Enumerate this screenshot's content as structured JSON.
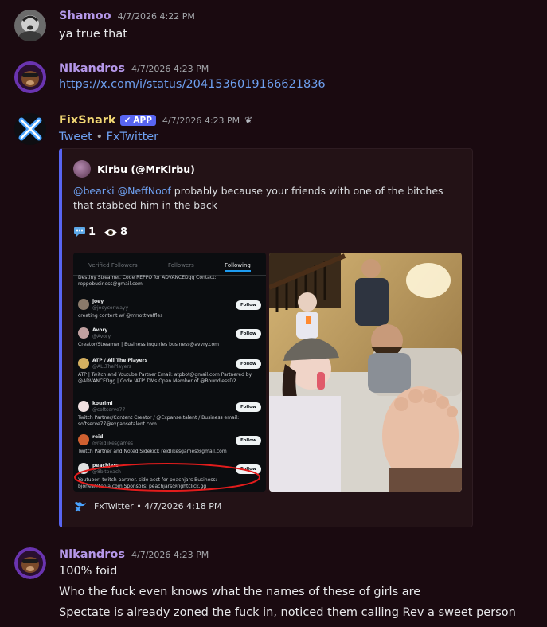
{
  "messages": [
    {
      "username": "Shamoo",
      "username_color": "#b497e8",
      "timestamp": "4/7/2026 4:22 PM",
      "lines": [
        "ya true that"
      ]
    },
    {
      "username": "Nikandros",
      "username_color": "#b497e8",
      "timestamp": "4/7/2026 4:23 PM",
      "link": "https://x.com/i/status/2041536019166621836"
    },
    {
      "username": "FixSnark",
      "username_color": "#f0d672",
      "badge": "APP",
      "timestamp": "4/7/2026 4:23 PM",
      "links": [
        "Tweet",
        "FxTwitter"
      ],
      "separator": "•",
      "embed": {
        "author": "Kirbu (@MrKirbu)",
        "mention1": "@bearki",
        "mention2": "@NeffNoof",
        "text": " probably because your friends with one of the bitches that stabbed him in the back",
        "replies": "1",
        "views": "8",
        "footer": "FxTwitter • 4/7/2026 4:18 PM",
        "accent_color": "#5865f2",
        "screenshot": {
          "tabs": [
            "Verified Followers",
            "Followers",
            "Following"
          ],
          "top_text": "Destiny Streamer. Code REPPO for ADVANCEDgg Contact: reppobusiness@gmail.com",
          "follow_label": "Follow",
          "accounts": [
            {
              "name": "joey",
              "handle": "@joeyconwayy",
              "bio": "creating content w/ @mrrottwaffles"
            },
            {
              "name": "Avory",
              "handle": "@Avory",
              "bio": "Creator/Streamer | Business Inquiries business@avvry.com"
            },
            {
              "name": "ATP / All The Players",
              "handle": "@ALLThePlayers",
              "bio": "ATP | Twitch and Youtube Partner Email: atpbot@gmail.com Partnered by @ADVANCEDgg | Code 'ATP' DMs Open Member of @BoundlessD2"
            },
            {
              "name": "kourimi",
              "handle": "@softserve77",
              "bio": "Twitch Partner/Content Creator / @Expanse.talent / Business email: softserve77@expansetalent.com"
            },
            {
              "name": "reid",
              "handle": "@reidlikesgames",
              "bio": "Twitch Partner and Noted Sidekick reidlikesgames@gmail.com"
            },
            {
              "name": "peachjars",
              "handle": "@8bitpeach",
              "bio": "Youtuber, twitch partner. side acct for peachjars Business: bjones@tepla.com Sponsors: peachjars@rightclick.gg"
            }
          ]
        }
      }
    },
    {
      "username": "Nikandros",
      "username_color": "#b497e8",
      "timestamp": "4/7/2026 4:23 PM",
      "lines": [
        "100% foid",
        "Who the fuck even knows what the names of these of girls are",
        "Spectate is already zoned the fuck in, noticed them calling Rev a sweet person"
      ]
    }
  ]
}
